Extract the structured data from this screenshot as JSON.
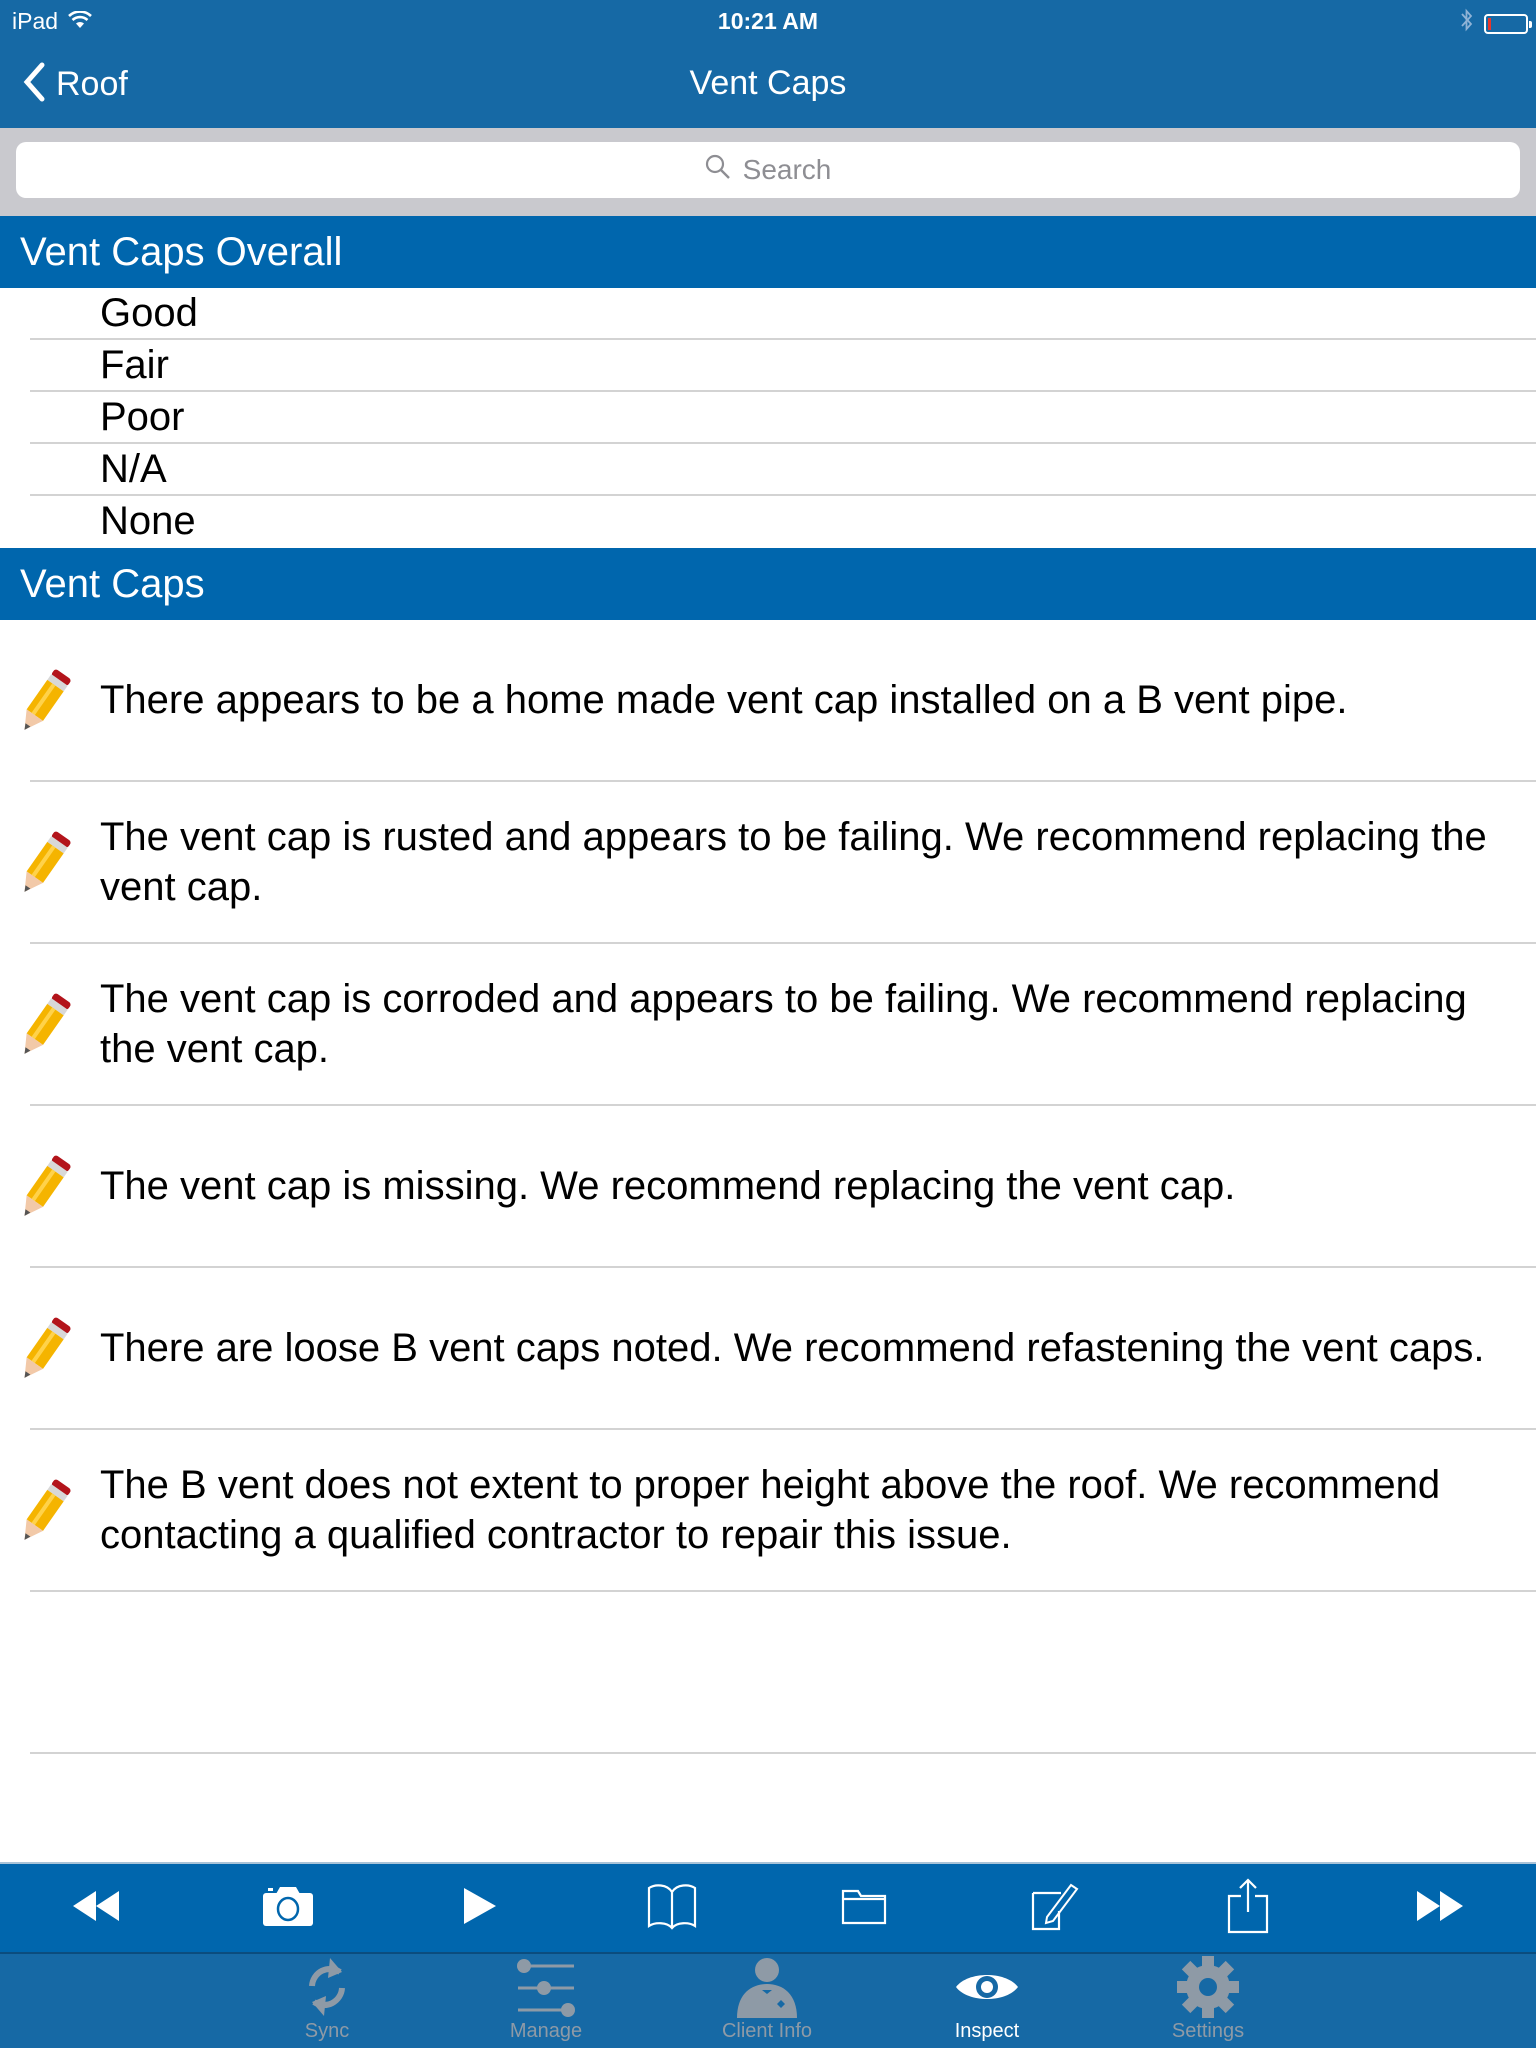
{
  "status_bar": {
    "device": "iPad",
    "time": "10:21 AM",
    "battery_percent": 5
  },
  "nav": {
    "back_label": "Roof",
    "title": "Vent Caps"
  },
  "search": {
    "placeholder": "Search",
    "value": ""
  },
  "sections": {
    "overall": {
      "title": "Vent Caps Overall",
      "items": [
        "Good",
        "Fair",
        "Poor",
        "N/A",
        "None"
      ]
    },
    "comments": {
      "title": "Vent Caps",
      "items": [
        "There appears to be a home made vent cap installed on a B vent pipe.",
        "The vent cap is rusted and appears to be failing. We recommend replacing the vent cap.",
        "The vent cap is corroded and appears to be failing. We recommend replacing the vent cap.",
        "The vent cap is missing. We recommend replacing the vent cap.",
        "There are loose B vent caps noted. We recommend refastening the vent caps.",
        "The B vent does not extent to proper height above the roof. We recommend contacting a qualified contractor to repair this issue."
      ]
    }
  },
  "toolbar": {
    "icons": [
      "rewind-icon",
      "camera-icon",
      "play-icon",
      "book-icon",
      "folder-icon",
      "edit-icon",
      "share-icon",
      "fast-forward-icon"
    ]
  },
  "tabbar": {
    "tabs": [
      {
        "label": "Sync",
        "icon": "sync-icon",
        "active": false
      },
      {
        "label": "Manage",
        "icon": "sliders-icon",
        "active": false
      },
      {
        "label": "Client Info",
        "icon": "person-icon",
        "active": false
      },
      {
        "label": "Inspect",
        "icon": "eye-icon",
        "active": true
      },
      {
        "label": "Settings",
        "icon": "gear-icon",
        "active": false
      }
    ]
  },
  "colors": {
    "nav_bar": "#1669a5",
    "section_header": "#0066ad",
    "search_bg": "#c9c9ce",
    "battery_low": "#e8362b",
    "tab_inactive": "#8e9aa6",
    "tab_active": "#ffffff"
  }
}
